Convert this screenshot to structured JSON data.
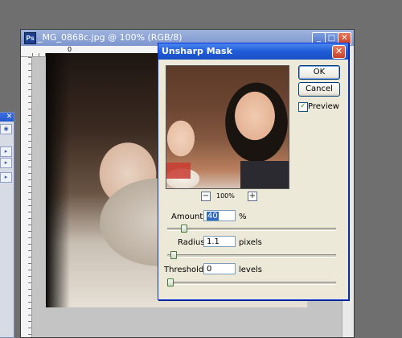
{
  "document": {
    "title": "_MG_0868c.jpg @ 100% (RGB/8)",
    "ruler_origin": "0",
    "buttons": {
      "minimize": "_",
      "maximize": "□",
      "close": "✕"
    }
  },
  "left_palette": {
    "close": "✕",
    "buttons": [
      "◉",
      "▸",
      "▸",
      "▸"
    ]
  },
  "dialog": {
    "title": "Unsharp Mask",
    "close": "✕",
    "ok_label": "OK",
    "cancel_label": "Cancel",
    "preview_label": "Preview",
    "preview_checked": true,
    "zoom": {
      "minus": "−",
      "plus": "+",
      "level": "100%"
    },
    "fields": {
      "amount": {
        "label": "Amount:",
        "value": "40",
        "unit": "%",
        "slider_fraction": 0.08
      },
      "radius": {
        "label": "Radius:",
        "value": "1.1",
        "unit": "pixels",
        "slider_fraction": 0.02
      },
      "threshold": {
        "label": "Threshold:",
        "value": "0",
        "unit": "levels",
        "slider_fraction": 0.0
      }
    }
  },
  "colors": {
    "titlebar_blue": "#1f5cd8",
    "dialog_bg": "#ece9d8",
    "workspace": "#6f6f6f"
  }
}
